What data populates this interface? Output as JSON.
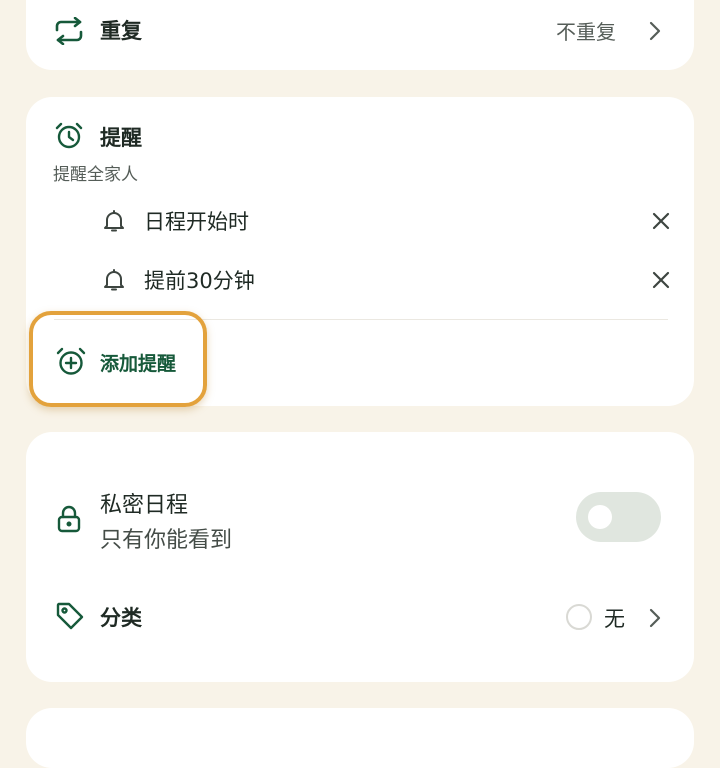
{
  "repeat": {
    "label": "重复",
    "value": "不重复"
  },
  "reminder": {
    "title": "提醒",
    "subtitle": "提醒全家人",
    "items": [
      {
        "label": "日程开始时"
      },
      {
        "label": "提前30分钟"
      }
    ],
    "add_label": "添加提醒"
  },
  "private": {
    "title": "私密日程",
    "subtitle": "只有你能看到",
    "toggle_on": false
  },
  "category": {
    "label": "分类",
    "value": "无"
  },
  "colors": {
    "accent_green": "#16593a",
    "highlight_orange": "#e3a23c",
    "background": "#f8f3e8",
    "toggle_off": "#e0e6df"
  },
  "icons": [
    "repeat-icon",
    "alarm-clock-icon",
    "bell-icon",
    "close-icon",
    "add-alarm-icon",
    "lock-icon",
    "tag-icon",
    "chevron-right-icon"
  ]
}
